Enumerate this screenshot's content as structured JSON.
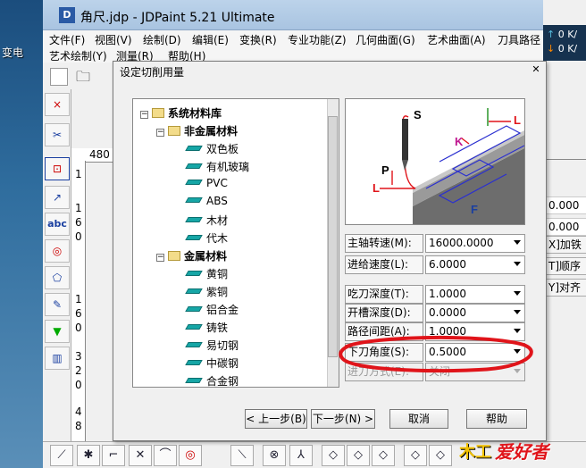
{
  "desktop": {
    "label": "变电"
  },
  "window": {
    "title": "角尺.jdp - JDPaint 5.21 Ultimate",
    "icon": "JD-app-icon"
  },
  "network": {
    "up": "0 K/",
    "down": "0 K/"
  },
  "menu": {
    "row1": [
      "文件(F)",
      "视图(V)",
      "绘制(D)",
      "编辑(E)",
      "变换(R)",
      "专业功能(Z)",
      "几何曲面(G)",
      "艺术曲面(A)",
      "刀具路径"
    ],
    "row2": [
      "艺术绘制(Y)",
      "测量(R)",
      "帮助(H)"
    ]
  },
  "ruler": {
    "h": "480",
    "v": [
      "1",
      "1",
      "6",
      "0",
      "1",
      "6",
      "0",
      "3",
      "2",
      "0",
      "4",
      "8"
    ]
  },
  "right_panel": {
    "vals": [
      "0.000",
      "0.000"
    ],
    "buttons": [
      "X]加铁",
      "T]顺序",
      "Y]对齐"
    ]
  },
  "dialog": {
    "title": "设定切削用量",
    "close": "✕",
    "tree": {
      "root": "系统材料库",
      "groups": [
        {
          "name": "非金属材料",
          "items": [
            "双色板",
            "有机玻璃",
            "PVC",
            "ABS",
            "木材",
            "代木"
          ]
        },
        {
          "name": "金属材料",
          "items": [
            "黄铜",
            "紫铜",
            "铝合金",
            "铸铁",
            "易切钢",
            "中碳钢",
            "合金钢"
          ]
        }
      ]
    },
    "preview_labels": {
      "s": "S",
      "p": "P",
      "l1": "L",
      "l2": "L",
      "k": "K",
      "f": "F"
    },
    "fields": [
      {
        "label": "主轴转速(M):",
        "value": "16000.0000"
      },
      {
        "label": "进给速度(L):",
        "value": "6.0000"
      },
      {
        "label": "吃刀深度(T):",
        "value": "1.0000"
      },
      {
        "label": "开槽深度(D):",
        "value": "0.0000"
      },
      {
        "label": "路径间距(A):",
        "value": "1.0000"
      },
      {
        "label": "下刀角度(S):",
        "value": "0.5000"
      },
      {
        "label": "进刀方式(E):",
        "value": "关闭"
      }
    ],
    "buttons": {
      "prev": "< 上一步(B)",
      "next": "下一步(N) >",
      "cancel": "取消",
      "help": "帮助"
    }
  },
  "watermark": {
    "text": "爱好者",
    "prefix": "木工"
  },
  "colors": {
    "highlight": "#e0141a",
    "accent": "#2a5aa5"
  }
}
